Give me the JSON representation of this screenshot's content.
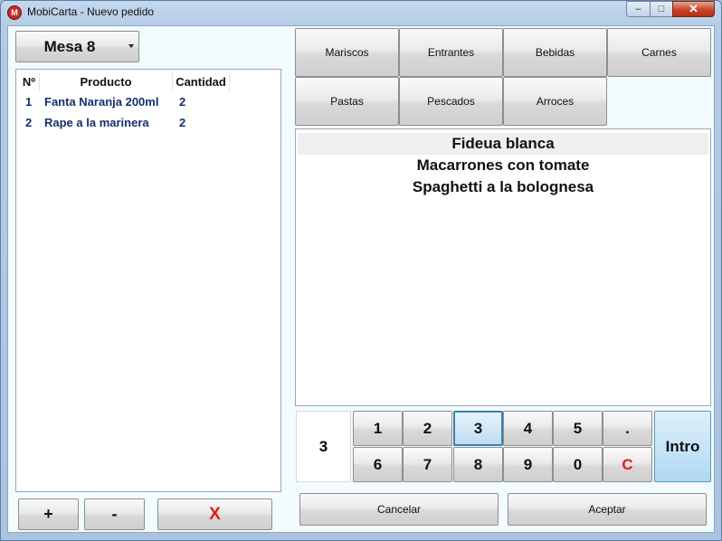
{
  "window": {
    "title": "MobiCarta - Nuevo pedido",
    "app_icon_glyph": "M",
    "controls": {
      "minimize": "‒",
      "maximize": "□",
      "close": "✕"
    }
  },
  "table_selector": {
    "value": "Mesa 8"
  },
  "order": {
    "columns": [
      "Nº",
      "Producto",
      "Cantidad"
    ],
    "rows": [
      {
        "no": "1",
        "product": "Fanta Naranja 200ml",
        "qty": "2"
      },
      {
        "no": "2",
        "product": "Rape a la marinera",
        "qty": "2"
      }
    ]
  },
  "order_actions": {
    "add": "+",
    "remove": "-",
    "delete": "X"
  },
  "categories": [
    "Mariscos",
    "Entrantes",
    "Bebidas",
    "Carnes",
    "Pastas",
    "Pescados",
    "Arroces"
  ],
  "products": [
    {
      "name": "Fideua blanca",
      "selected": true
    },
    {
      "name": "Macarrones con tomate",
      "selected": false
    },
    {
      "name": "Spaghetti a la bolognesa",
      "selected": false
    }
  ],
  "keypad": {
    "display": "3",
    "row1": [
      "1",
      "2",
      "3",
      "4",
      "5",
      "."
    ],
    "row2": [
      "6",
      "7",
      "8",
      "9",
      "0",
      "C"
    ],
    "active_key": "3",
    "enter": "Intro"
  },
  "footer": {
    "cancel": "Cancelar",
    "accept": "Aceptar"
  },
  "colors": {
    "accent": "#3d7fae",
    "danger": "#e01c1c",
    "row_text": "#142f6e"
  }
}
